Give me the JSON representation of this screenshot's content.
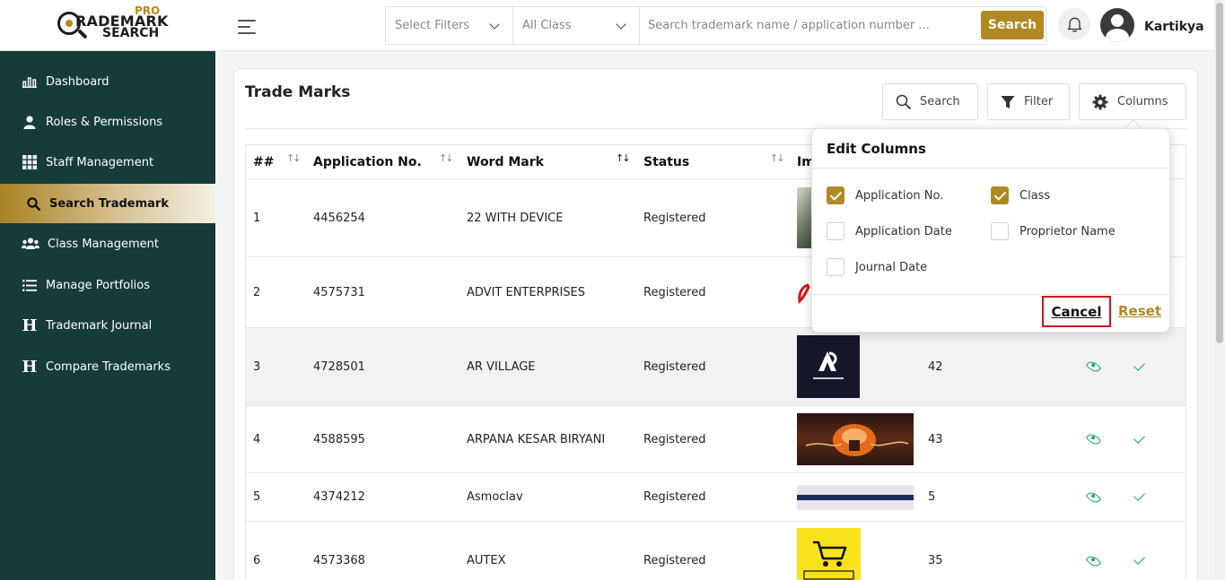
{
  "logo": {
    "pro": "PRO",
    "line1": "RADEMARK",
    "line2": "SEARCH"
  },
  "sidebar": {
    "items": [
      {
        "label": "Dashboard",
        "icon": "bar-chart-icon"
      },
      {
        "label": "Roles & Permissions",
        "icon": "user-icon"
      },
      {
        "label": "Staff Management",
        "icon": "grid-icon"
      },
      {
        "label": "Search Trademark",
        "icon": "search-icon",
        "active": true
      },
      {
        "label": "Class Management",
        "icon": "users-icon"
      },
      {
        "label": "Manage Portfolios",
        "icon": "list-icon"
      },
      {
        "label": "Trademark Journal",
        "icon": "h-icon"
      },
      {
        "label": "Compare Trademarks",
        "icon": "h-icon"
      }
    ]
  },
  "topbar": {
    "filter_select": "Select Filters",
    "class_select": "All Class",
    "search_placeholder": "Search trademark name / application number ...",
    "search_button": "Search",
    "user_name": "Kartikya"
  },
  "main": {
    "title": "Trade Marks",
    "toolbar": {
      "search": "Search",
      "filter": "Filter",
      "columns": "Columns"
    },
    "table": {
      "headers": [
        "##",
        "Application No.",
        "Word Mark",
        "Status",
        "Im"
      ],
      "rows": [
        {
          "n": "1",
          "app": "4456254",
          "mark": "22 WITH DEVICE",
          "status": "Registered",
          "class": ""
        },
        {
          "n": "2",
          "app": "4575731",
          "mark": "ADVIT ENTERPRISES",
          "status": "Registered",
          "class": ""
        },
        {
          "n": "3",
          "app": "4728501",
          "mark": "AR VILLAGE",
          "status": "Registered",
          "class": "42"
        },
        {
          "n": "4",
          "app": "4588595",
          "mark": "ARPANA KESAR BIRYANI",
          "status": "Registered",
          "class": "43"
        },
        {
          "n": "5",
          "app": "4374212",
          "mark": "Asmoclav",
          "status": "Registered",
          "class": "5"
        },
        {
          "n": "6",
          "app": "4573368",
          "mark": "AUTEX",
          "status": "Registered",
          "class": "35"
        }
      ]
    }
  },
  "edit_columns": {
    "title": "Edit Columns",
    "options": [
      {
        "label": "Application No.",
        "checked": true
      },
      {
        "label": "Class",
        "checked": true
      },
      {
        "label": "Application Date",
        "checked": false
      },
      {
        "label": "Proprietor Name",
        "checked": false
      },
      {
        "label": "Journal Date",
        "checked": false
      }
    ],
    "cancel": "Cancel",
    "reset": "Reset"
  },
  "colors": {
    "sidebar": "#163c3a",
    "accent": "#b08a20",
    "success": "#21a46f",
    "highlight": "#d0151b"
  }
}
